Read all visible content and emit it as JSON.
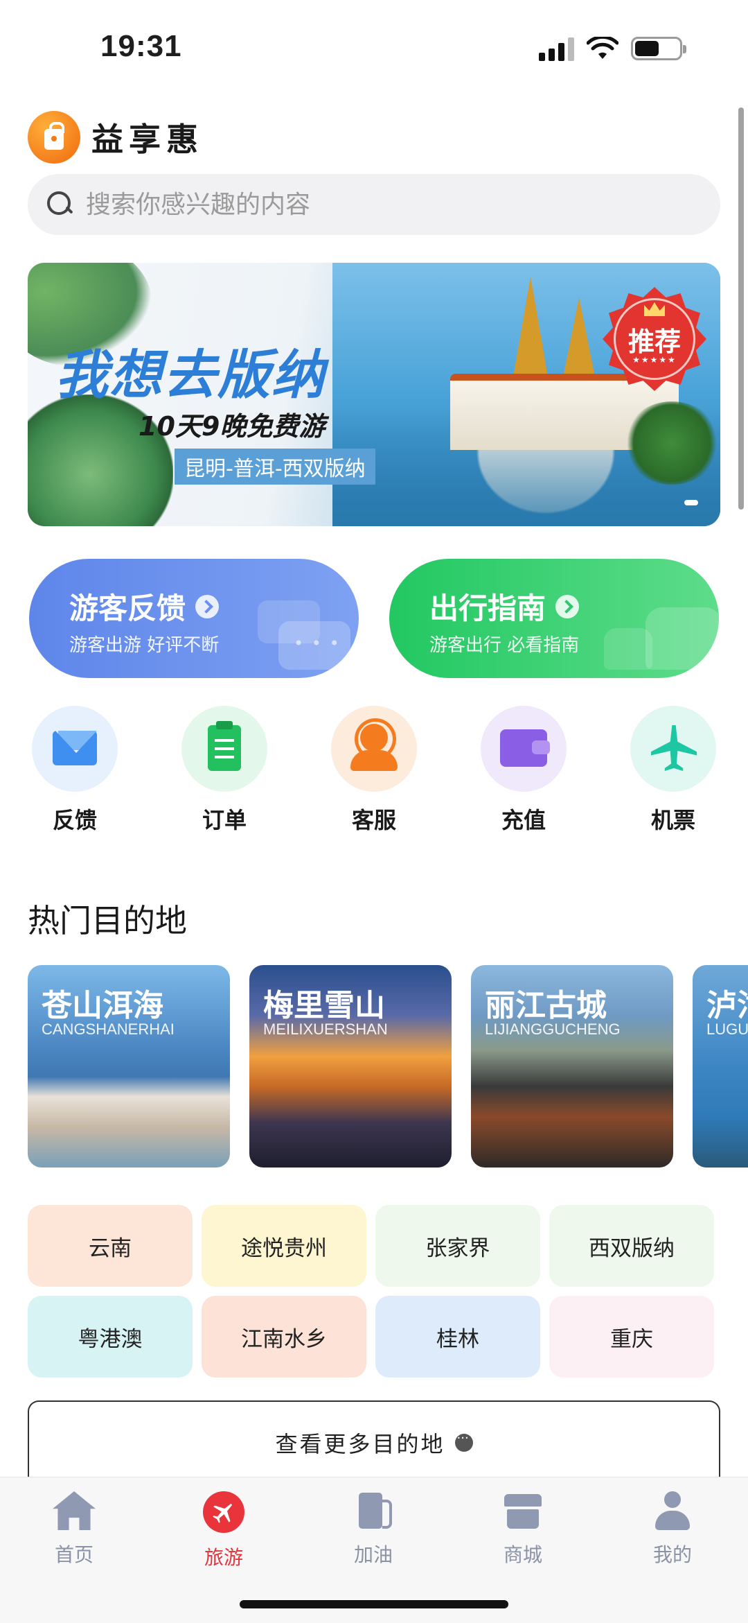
{
  "status_bar": {
    "time": "19:31",
    "icons": [
      "cellular-signal-icon",
      "wifi-icon",
      "battery-icon"
    ]
  },
  "header": {
    "app_name": "益享惠",
    "logo_icon": "shopping-bag-logo-icon"
  },
  "search": {
    "placeholder": "搜索你感兴趣的内容",
    "value": ""
  },
  "banner": {
    "title": "我想去版纳",
    "subtitle": "10天9晚免费游",
    "route": "昆明-普洱-西双版纳",
    "badge": "推荐",
    "badge_stars": "★★★★★"
  },
  "promos": [
    {
      "title": "游客反馈",
      "subtitle": "游客出游 好评不断",
      "color": "#6a8fee"
    },
    {
      "title": "出行指南",
      "subtitle": "游客出行 必看指南",
      "color": "#2fd06e"
    }
  ],
  "quick_actions": [
    {
      "label": "反馈",
      "icon": "mail-icon"
    },
    {
      "label": "订单",
      "icon": "clipboard-icon"
    },
    {
      "label": "客服",
      "icon": "customer-service-icon"
    },
    {
      "label": "充值",
      "icon": "wallet-icon"
    },
    {
      "label": "机票",
      "icon": "airplane-icon"
    }
  ],
  "hot_destinations": {
    "title": "热门目的地",
    "items": [
      {
        "name": "苍山洱海",
        "pinyin": "CANGSHANERHAI"
      },
      {
        "name": "梅里雪山",
        "pinyin": "MEILIXUERSHAN"
      },
      {
        "name": "丽江古城",
        "pinyin": "LIJIANGGUCHENG"
      },
      {
        "name": "泸沽",
        "pinyin": "LUGU"
      }
    ]
  },
  "destination_tags": [
    {
      "label": "云南",
      "color": "#fde5d8"
    },
    {
      "label": "途悦贵州",
      "color": "#fdf6d0"
    },
    {
      "label": "张家界",
      "color": "#eef8ec"
    },
    {
      "label": "西双版纳",
      "color": "#eef8ec"
    },
    {
      "label": "粤港澳",
      "color": "#d8f3f4"
    },
    {
      "label": "江南水乡",
      "color": "#fde2d8"
    },
    {
      "label": "桂林",
      "color": "#ddebfb"
    },
    {
      "label": "重庆",
      "color": "#fcf0f4"
    }
  ],
  "more_button": {
    "label": "查看更多目的地"
  },
  "tab_bar": {
    "active": "旅游",
    "active_color": "#e8343a",
    "inactive_color": "#8a93a6",
    "items": [
      {
        "label": "首页",
        "icon": "home-icon"
      },
      {
        "label": "旅游",
        "icon": "travel-plane-icon"
      },
      {
        "label": "加油",
        "icon": "fuel-pump-icon"
      },
      {
        "label": "商城",
        "icon": "store-icon"
      },
      {
        "label": "我的",
        "icon": "user-icon"
      }
    ]
  }
}
